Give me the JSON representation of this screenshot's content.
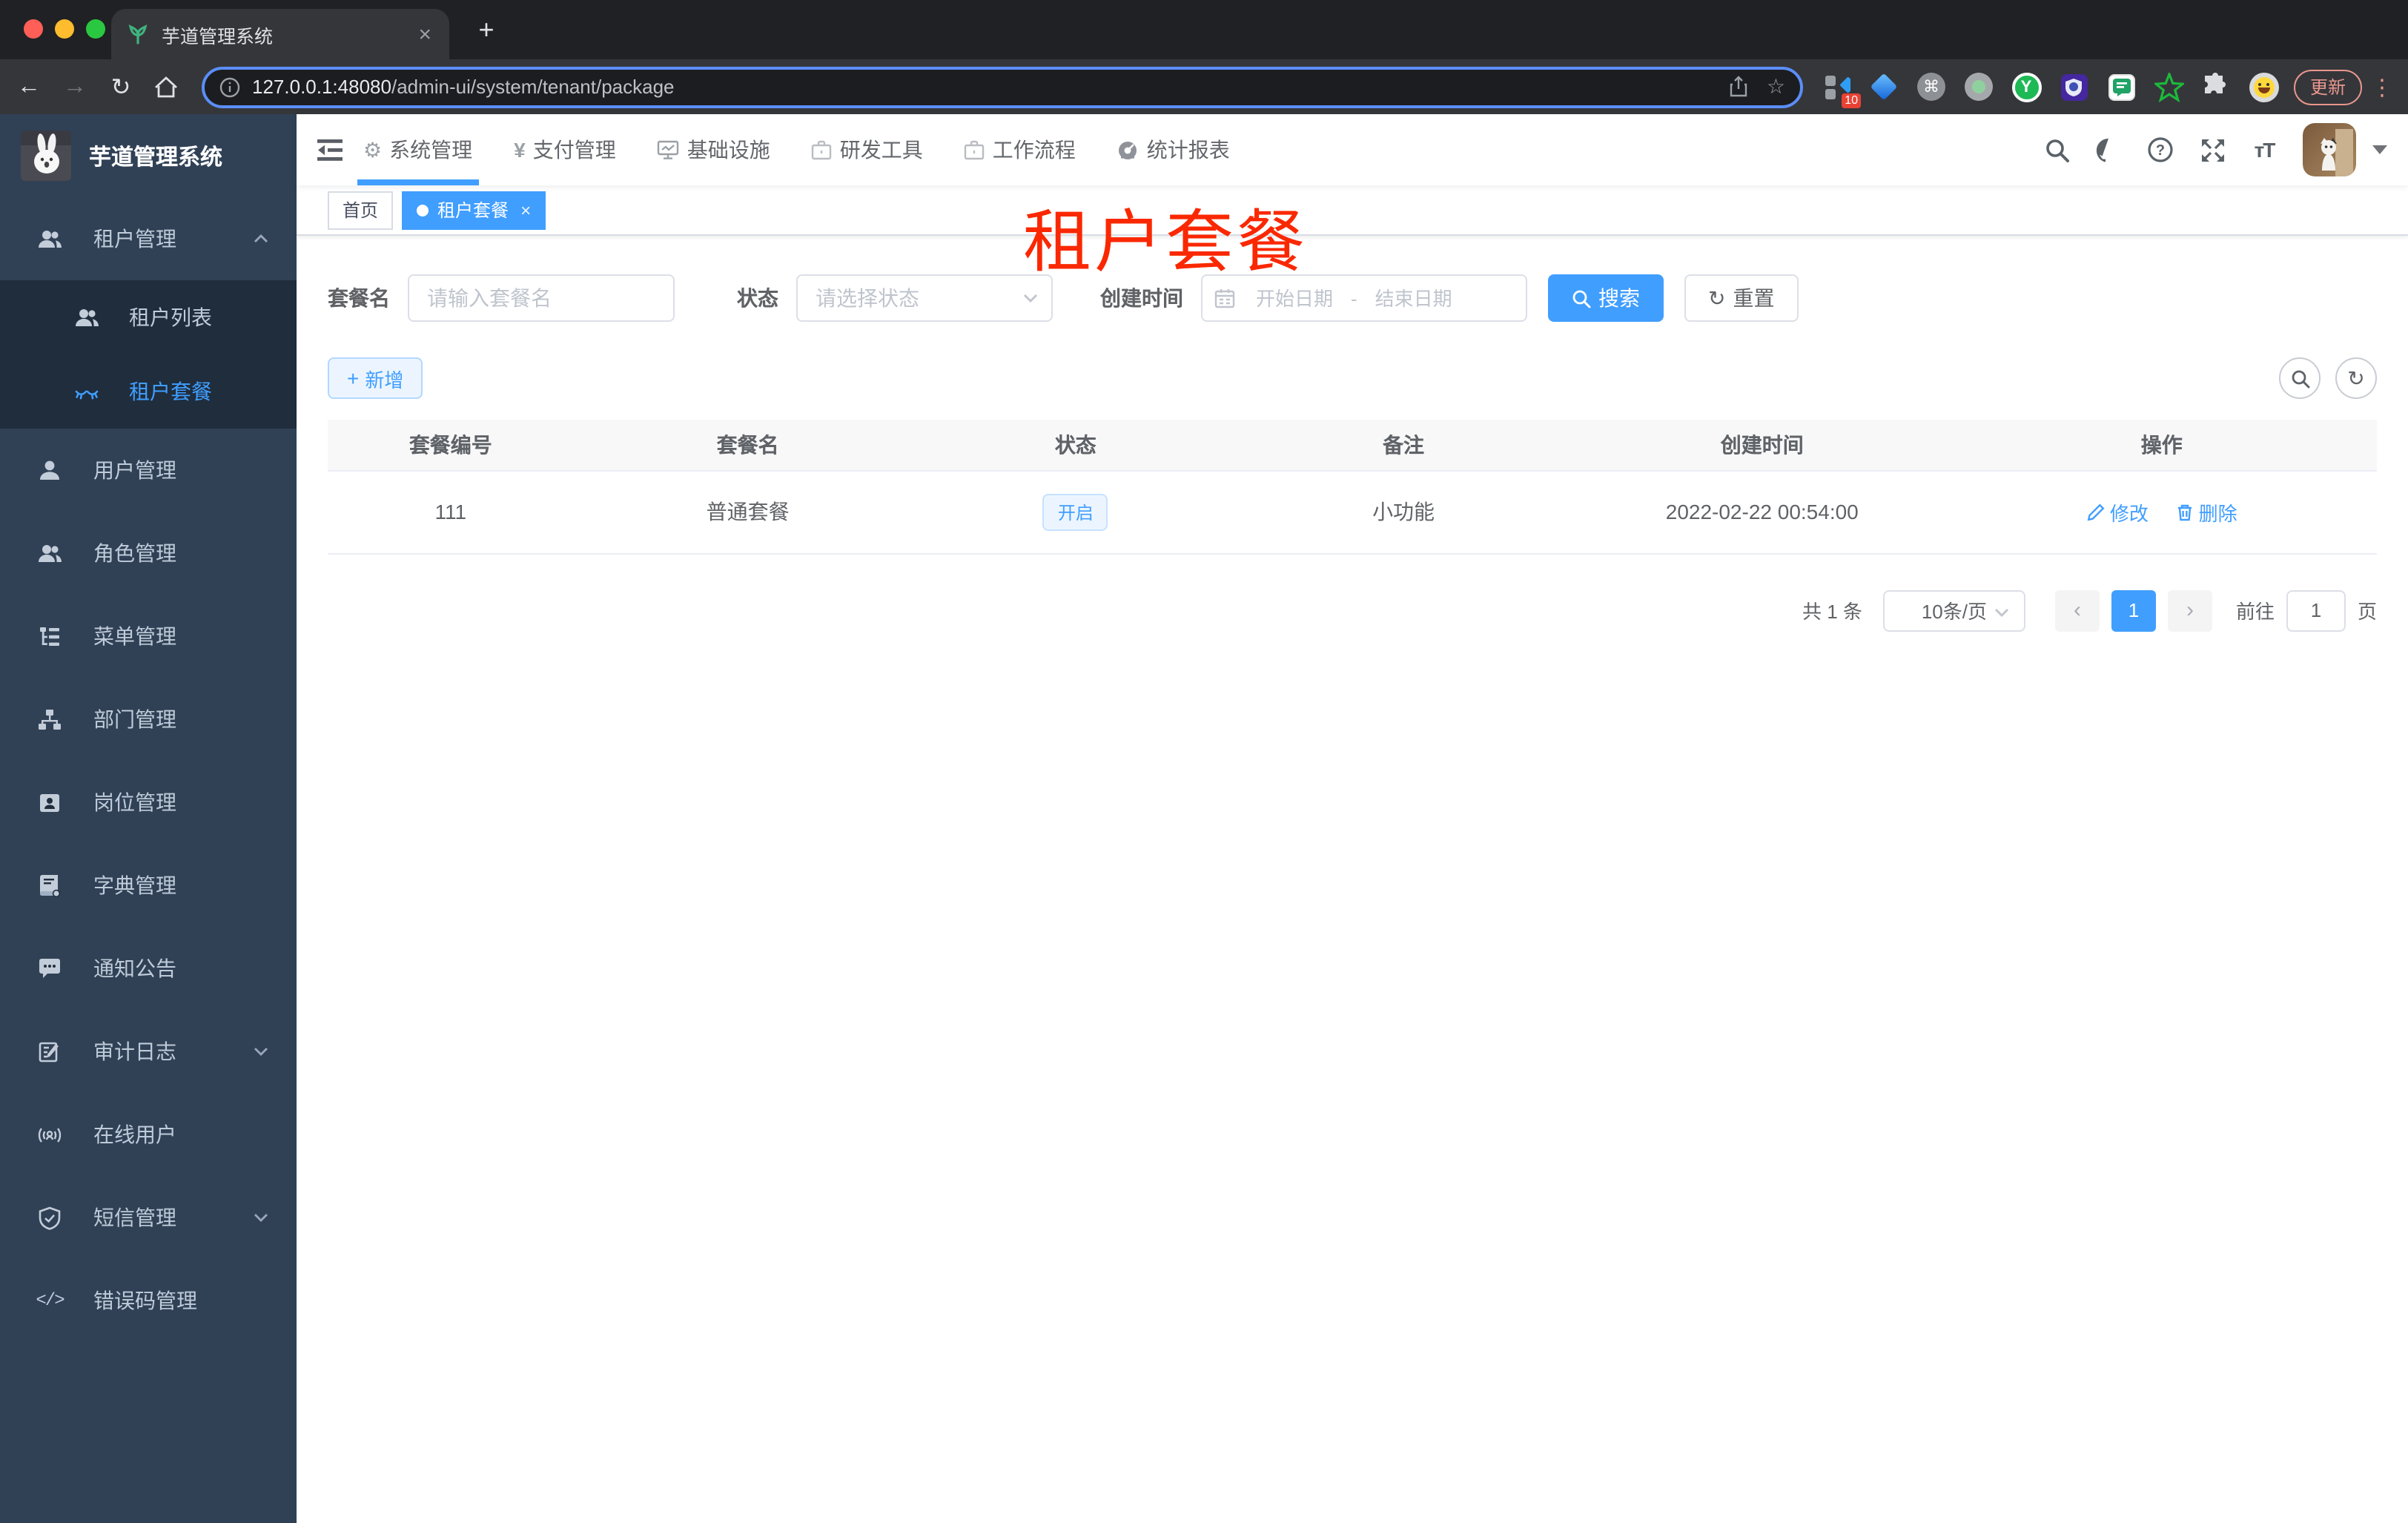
{
  "browser": {
    "tab_title": "芋道管理系统",
    "url_host": "127.0.0.1:48080",
    "url_path": "/admin-ui/system/tenant/package",
    "update_label": "更新",
    "extension_badge": "10"
  },
  "icons": {
    "close": "×",
    "plus": "+",
    "back": "←",
    "forward": "→",
    "reload": "↻",
    "star": "☆",
    "gear": "⚙",
    "yen": "¥",
    "question": "?",
    "command": "⌘",
    "kebab": "⋮",
    "prev": "‹",
    "next": "›",
    "font_size": "тT",
    "code_glyph": "</>",
    "y_logo": "Y"
  },
  "sidebar": {
    "app_title": "芋道管理系统",
    "items": [
      {
        "label": "租户管理"
      },
      {
        "label": "租户列表"
      },
      {
        "label": "租户套餐"
      },
      {
        "label": "用户管理"
      },
      {
        "label": "角色管理"
      },
      {
        "label": "菜单管理"
      },
      {
        "label": "部门管理"
      },
      {
        "label": "岗位管理"
      },
      {
        "label": "字典管理"
      },
      {
        "label": "通知公告"
      },
      {
        "label": "审计日志"
      },
      {
        "label": "在线用户"
      },
      {
        "label": "短信管理"
      },
      {
        "label": "错误码管理"
      }
    ]
  },
  "header": {
    "menus": [
      {
        "label": "系统管理"
      },
      {
        "label": "支付管理"
      },
      {
        "label": "基础设施"
      },
      {
        "label": "研发工具"
      },
      {
        "label": "工作流程"
      },
      {
        "label": "统计报表"
      }
    ]
  },
  "tags": {
    "home": "首页",
    "active": "租户套餐"
  },
  "overlay": {
    "page_label": "租户套餐"
  },
  "filters": {
    "name_label": "套餐名",
    "name_placeholder": "请输入套餐名",
    "status_label": "状态",
    "status_placeholder": "请选择状态",
    "date_label": "创建时间",
    "date_start_placeholder": "开始日期",
    "date_separator": "-",
    "date_end_placeholder": "结束日期",
    "search_label": "搜索",
    "reset_label": "重置"
  },
  "toolbar": {
    "add_label": "新增"
  },
  "table": {
    "headers": [
      "套餐编号",
      "套餐名",
      "状态",
      "备注",
      "创建时间",
      "操作"
    ],
    "rows": [
      {
        "id": "111",
        "name": "普通套餐",
        "status": "开启",
        "remark": "小功能",
        "create_time": "2022-02-22 00:54:00",
        "edit_label": "修改",
        "delete_label": "删除"
      }
    ]
  },
  "pagination": {
    "total_text": "共 1 条",
    "page_size": "10条/页",
    "current_page": "1",
    "goto_label": "前往",
    "goto_value": "1",
    "page_unit": "页"
  },
  "colors": {
    "accent": "#409eff",
    "annotation_red": "#fa2800",
    "sidebar_bg": "#304156",
    "submenu_bg": "#1f2d3d"
  }
}
